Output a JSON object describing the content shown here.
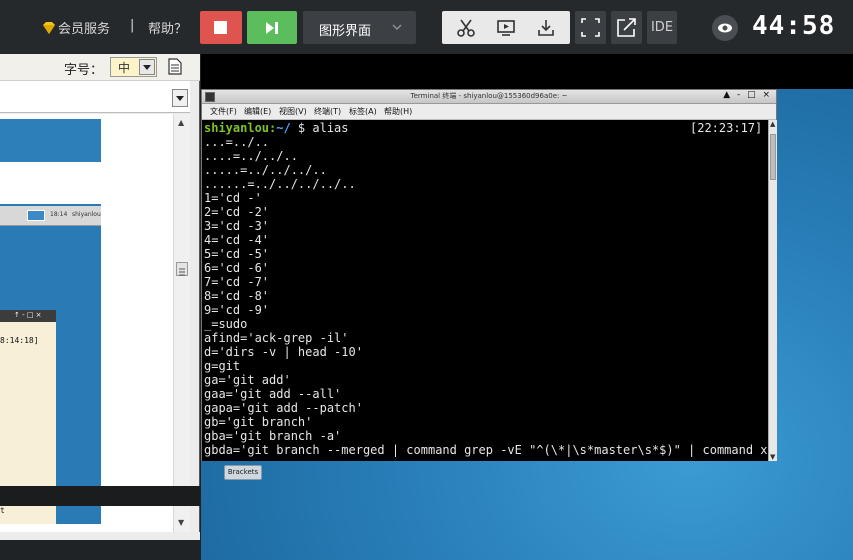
{
  "toolbar": {
    "member_label": "会员服务",
    "separator": "|",
    "help_label": "帮助？",
    "mode_label": "图形界面",
    "ide_label": "IDE",
    "timer": "44:58"
  },
  "left_panel": {
    "font_label": "字号：",
    "font_size_value": "中",
    "mini_clock": "18:14",
    "mini_user": "shiyanlou",
    "mini_term_controls": "↑ - □ ×",
    "mini_term_time": "8:14:18]",
    "mini_term_last": "t"
  },
  "terminal": {
    "title": "Terminal 终端 - shiyanlou@155360d96a0e: ~",
    "window_controls": "▲ - □ ×",
    "menu": [
      "文件(F)",
      "编辑(E)",
      "视图(V)",
      "终端(T)",
      "标签(A)",
      "帮助(H)"
    ],
    "prompt_user": "shiyanlou:",
    "prompt_path": "~/",
    "prompt_cmd": " $ alias",
    "time": "[22:23:17]",
    "lines": [
      "...=../..",
      "....=../../..",
      ".....=../../../..",
      "......=../../../../..",
      "1='cd -'",
      "2='cd -2'",
      "3='cd -3'",
      "4='cd -4'",
      "5='cd -5'",
      "6='cd -6'",
      "7='cd -7'",
      "8='cd -8'",
      "9='cd -9'",
      "_=sudo",
      "afind='ack-grep -il'",
      "d='dirs -v | head -10'",
      "g=git",
      "ga='git add'",
      "gaa='git add --all'",
      "gapa='git add --patch'",
      "gb='git branch'",
      "gba='git branch -a'",
      "gbda='git branch --merged | command grep -vE \"^(\\*|\\s*master\\s*$)\" | command xar"
    ]
  },
  "desktop": {
    "taskbar_item": "Brackets"
  }
}
